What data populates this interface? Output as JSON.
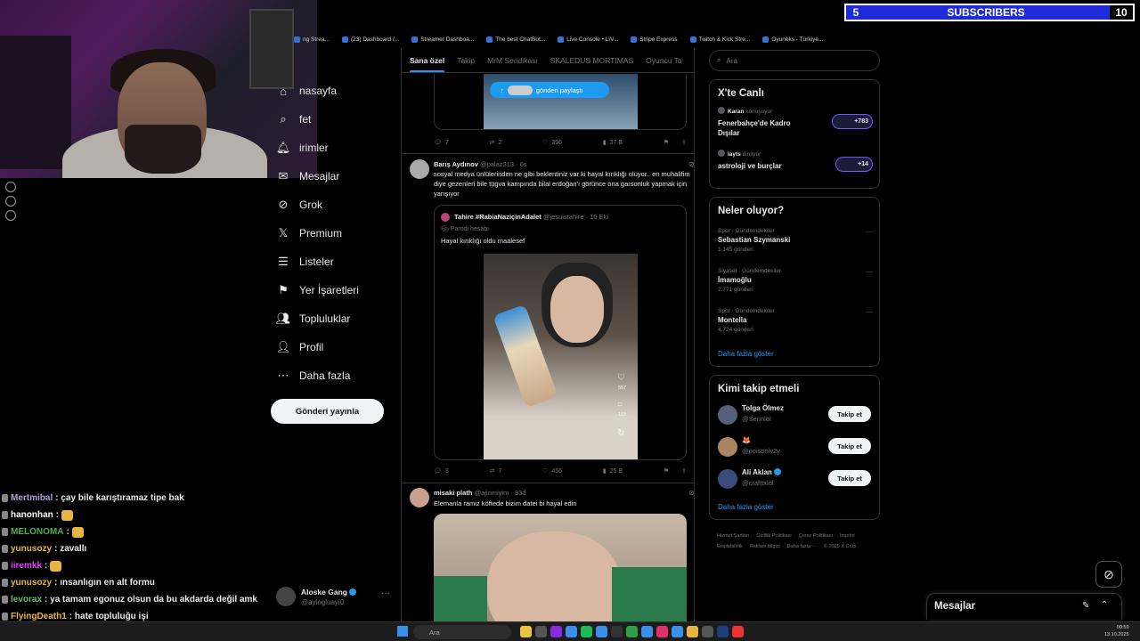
{
  "browser": {
    "bookmarks": [
      "ng Strea...",
      "(23) Dashboard /...",
      "Streamer Dashboa...",
      "The best ChatBot...",
      "Live Console • LIV...",
      "Stripe Express",
      "Twitch & Kick Stre...",
      "Oyuneks - Türkiye..."
    ]
  },
  "overlay": {
    "subscribers_label": "SUBSCRIBERS",
    "subscribers_count": "5",
    "subscribers_goal": "10"
  },
  "nav": {
    "items": [
      {
        "label": "nasayfa",
        "icon": "home-icon"
      },
      {
        "label": "fet",
        "icon": "explore-icon"
      },
      {
        "label": "irimler",
        "icon": "bell-icon"
      },
      {
        "label": "Mesajlar",
        "icon": "mail-icon"
      },
      {
        "label": "Grok",
        "icon": "grok-icon"
      },
      {
        "label": "Premium",
        "icon": "x-logo-icon"
      },
      {
        "label": "Listeler",
        "icon": "list-icon"
      },
      {
        "label": "Yer İşaretleri",
        "icon": "bookmark-icon"
      },
      {
        "label": "Topluluklar",
        "icon": "people-icon"
      },
      {
        "label": "Profil",
        "icon": "person-icon"
      },
      {
        "label": "Daha fazla",
        "icon": "more-circle-icon"
      }
    ],
    "post_button": "Gönderi yayınla"
  },
  "account": {
    "name": "Aloske Gang",
    "handle": "@ayiogluayi0",
    "more": "···"
  },
  "chat": [
    {
      "user": "Mertmibal",
      "color": "#b39ddb",
      "msg": ": çay bile karıştıramaz tipe bak",
      "emote": false
    },
    {
      "user": "hanonhan",
      "color": "#ffffff",
      "msg": ":",
      "emote": true
    },
    {
      "user": "MELONOMA",
      "color": "#4caf50",
      "msg": ":",
      "emote": true
    },
    {
      "user": "yunusozy",
      "color": "#e8b640",
      "msg": ": zavallı",
      "emote": false
    },
    {
      "user": "iiremkk",
      "color": "#e040fb",
      "msg": ":",
      "emote": true
    },
    {
      "user": "yunusozy",
      "color": "#e8b640",
      "msg": ": ınsanlıgın en alt formu",
      "emote": false
    },
    {
      "user": "levorax",
      "color": "#66bb6a",
      "msg": ": ya tamam egonuz olsun da bu akdarda değil amk",
      "emote": false
    },
    {
      "user": "FlyingDeath1",
      "color": "#e8b640",
      "msg": ": hate topluluğu işi",
      "emote": false
    }
  ],
  "feed": {
    "tabs": [
      "Sana özel",
      "Takip",
      "MrM Sendikası",
      "SKALEDUS MORTIMAS",
      "Oyuncu To"
    ],
    "share_pill": "gönderi paylaştı",
    "tweet0": {
      "replies": "7",
      "reposts": "2",
      "likes": "396",
      "views": "37 B"
    },
    "tweet1": {
      "name": "Barış Aydınov",
      "handle": "@palaz313",
      "time": "6s",
      "more": "···",
      "text": "sosyal medya ünlülerinden ne gibi beklentiniz var ki hayal kırıklığı oluyor.. en muhalifim diye gezenleri bile tügva kampında bilal erdoğan'ı görünce ona garsonluk yapmak için yarışıyor",
      "quote": {
        "name": "Tahire #RabiaNaziçinAdalet",
        "handle": "@jesuistahire",
        "time": "10 Eki",
        "badge": "Parodi hesabı",
        "text": "Hayal kırıklığı oldu maalesef",
        "video_likes": "557",
        "video_comments": "113"
      },
      "replies": "3",
      "reposts": "7",
      "likes": "456",
      "views": "25 B"
    },
    "tweet2": {
      "name": "misaki plath",
      "handle": "@ajinmiyim",
      "time": "33d",
      "more": "···",
      "text": "Elemanla ramiz köftede bizim datei bi hayal edin"
    }
  },
  "right": {
    "search_placeholder": "Ara",
    "live": {
      "title": "X'te Canlı",
      "items": [
        {
          "host": "Karan",
          "status": "konuşuyor",
          "title": "Fenerbahçe'de Kadro Dışılar",
          "count": "+783"
        },
        {
          "host": "layts",
          "status": "dinliyor",
          "title": "astroloji ve burçlar",
          "count": "+14"
        }
      ]
    },
    "trends": {
      "title": "Neler oluyor?",
      "items": [
        {
          "category": "Spor · Gündemdekiler",
          "name": "Sebastian Szymanski",
          "count": "1.145 gönderi"
        },
        {
          "category": "Siyaset · Gündemdekiler",
          "name": "İmamoğlu",
          "count": "2.771 gönderi"
        },
        {
          "category": "Spor · Gündemdekiler",
          "name": "Montella",
          "count": "4.724 gönderi"
        }
      ],
      "show_more": "Daha fazla göster"
    },
    "follow": {
      "title": "Kimi takip etmeli",
      "items": [
        {
          "name": "Tolga Ölmez",
          "handle": "@Serinlol",
          "verified": false
        },
        {
          "name": "🦊",
          "handle": "@poisoniv2y",
          "verified": false
        },
        {
          "name": "Ali Aklan",
          "handle": "@crafttxlol",
          "verified": true
        }
      ],
      "button": "Takip et",
      "show_more": "Daha fazla göster"
    },
    "footer": [
      "Hizmet Şartları",
      "Gizlilik Politikası",
      "Çerez Politikası",
      "Imprint",
      "Erişilebilirlik",
      "Reklam bilgisi",
      "Daha fazla ···",
      "© 2025 X Corp."
    ]
  },
  "messages_dock": {
    "title": "Mesajlar"
  },
  "taskbar": {
    "search": "Ara",
    "time": "00:59",
    "date": "13.10.2025"
  }
}
